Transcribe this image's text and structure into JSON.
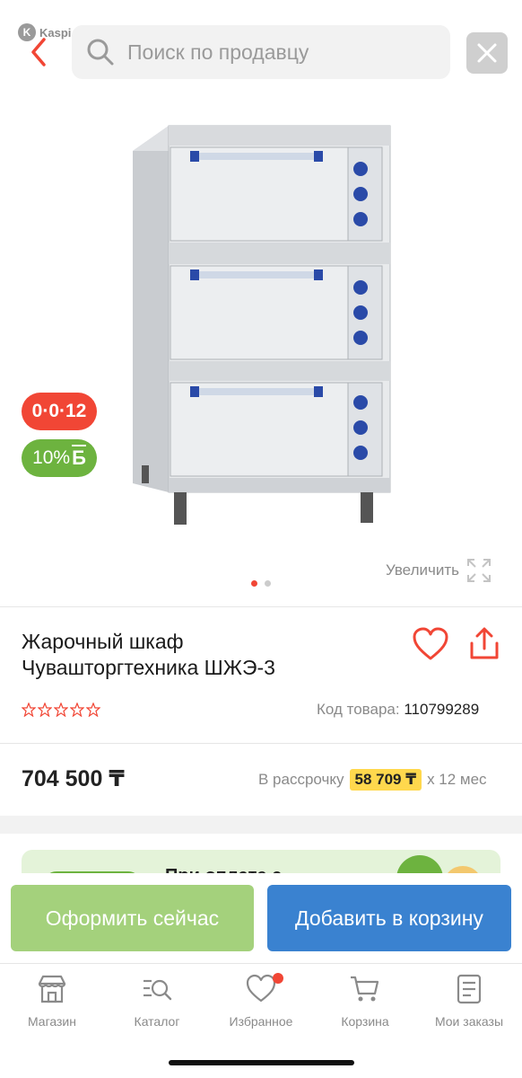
{
  "watermark": {
    "text": "Kaspi.kz"
  },
  "header": {
    "search_placeholder": "Поиск по продавцу",
    "back_icon": "chevron-left-icon",
    "close_icon": "close-icon"
  },
  "gallery": {
    "image_name": "product-oven-image",
    "badge_installment": "0·0·12",
    "badge_bonus_percent": "10%",
    "badge_bonus_symbol": "Б",
    "page_count": 2,
    "current_page": 1,
    "zoom_label": "Увеличить"
  },
  "product": {
    "title_line1": "Жарочный шкаф",
    "title_line2": "Чувашторгтехника ШЖЭ-3",
    "rating_stars": 0,
    "rating_max": 5,
    "sku_label": "Код товара:",
    "sku_value": "110799289",
    "price": "704 500 ₸",
    "installment_prefix": "В рассрочку",
    "installment_amount": "58 709 ₸",
    "installment_suffix": "x 12 мес"
  },
  "promo": {
    "text": "При оплате с"
  },
  "actions": {
    "order_now": "Оформить сейчас",
    "add_to_cart": "Добавить в корзину"
  },
  "tabbar": {
    "items": [
      {
        "label": "Магазин",
        "icon": "shop-icon"
      },
      {
        "label": "Каталог",
        "icon": "catalog-search-icon"
      },
      {
        "label": "Избранное",
        "icon": "heart-icon",
        "has_notification": true
      },
      {
        "label": "Корзина",
        "icon": "cart-icon"
      },
      {
        "label": "Мои заказы",
        "icon": "orders-icon"
      }
    ]
  },
  "colors": {
    "accent_red": "#f14635",
    "bonus_green": "#6db33f",
    "order_button": "#a4d17c",
    "cart_button": "#3a82d0",
    "installment_highlight": "#ffd84d"
  }
}
